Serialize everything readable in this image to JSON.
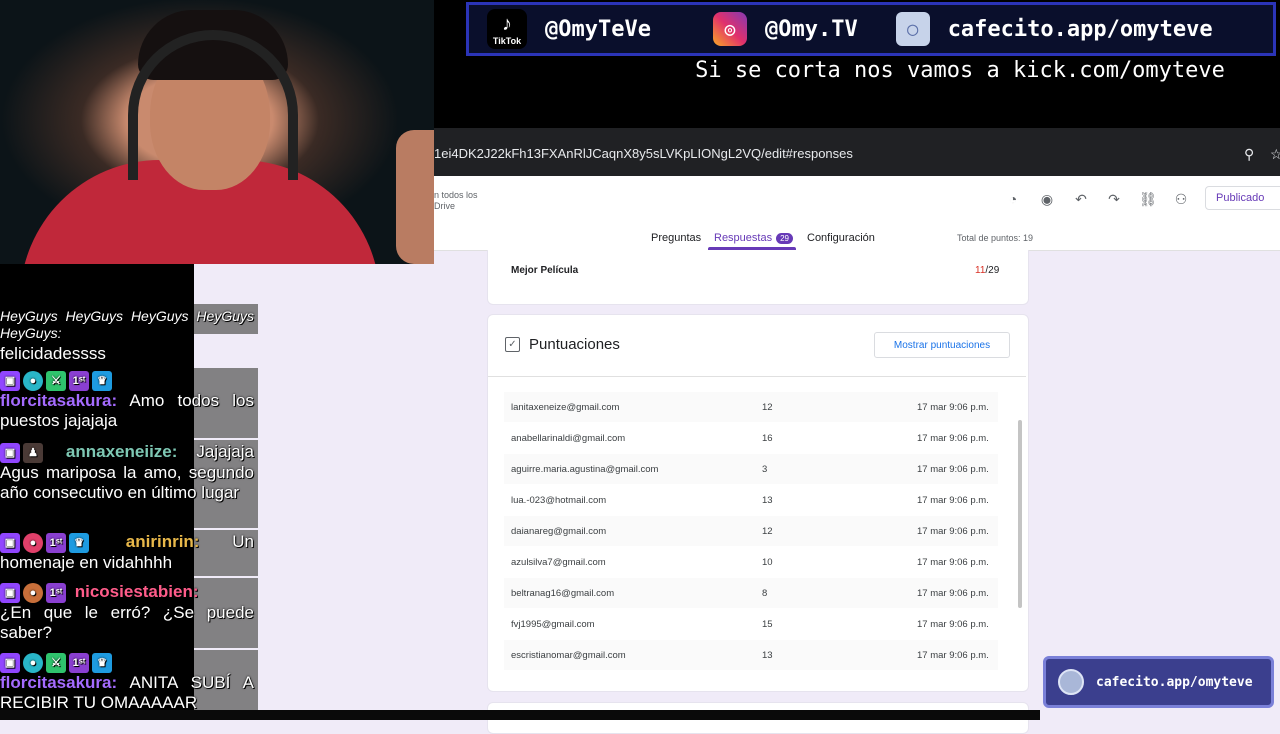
{
  "overlay": {
    "tiktok": {
      "icon": "tiktok-icon",
      "icon_label": "TikTok",
      "handle": "@OmyTeVe"
    },
    "instagram": {
      "icon": "instagram-icon",
      "handle": "@Omy.TV"
    },
    "cafecito": {
      "icon": "cafecito-icon",
      "handle": "cafecito.app/omyteve"
    },
    "banner": "Si se corta nos vamos a kick.com/omyteve",
    "bottom_badge": "cafecito.app/omyteve"
  },
  "chat": {
    "messages": [
      {
        "user": "",
        "text": "HeyGuys HeyGuys HeyGuys HeyGuys HeyGuys:"
      },
      {
        "user": "",
        "text": "felicidadessss"
      },
      {
        "user": "florcitasakura:",
        "user_color": "#a56bff",
        "text": "Amo todos los puestos jajajaja"
      },
      {
        "user": "annaxeneiize:",
        "user_color": "#7ec8b4",
        "text": "Jajajaja Agus mariposa la amo, segundo año consecutivo en último lugar"
      },
      {
        "user": "anirinrin:",
        "user_color": "#e8b84a",
        "text": "Un homenaje en vidahhhh"
      },
      {
        "user": "nicosiestabien:",
        "user_color": "#ff5c8a",
        "text": "¿En que le erró? ¿Se puede saber?"
      },
      {
        "user": "florcitasakura:",
        "user_color": "#a56bff",
        "text": "ANITA SUBÍ A RECIBIR TU OMAAAAAR"
      }
    ]
  },
  "browser": {
    "url": "1ei4DK2J22kFh13FXAnRlJCaqnX8y5sLVKpLIONgL2VQ/edit#responses",
    "zoom_icon": "zoom-icon",
    "star_icon": "star-icon"
  },
  "forms": {
    "drive_note_1": "n todos los",
    "drive_note_2": "Drive",
    "toolbar_icons": [
      "palette-icon",
      "preview-eye-icon",
      "undo-icon",
      "redo-icon",
      "link-icon",
      "add-collaborator-icon"
    ],
    "publish_label": "Publicado",
    "tabs": {
      "preguntas": "Preguntas",
      "respuestas": "Respuestas",
      "respuestas_count": "29",
      "configuracion": "Configuración"
    },
    "total_points": "Total de puntos: 19",
    "mejor_pelicula": {
      "label": "Mejor Película",
      "score_correct": "11",
      "score_total": "/29"
    },
    "puntuaciones": {
      "title": "Puntuaciones",
      "button": "Mostrar puntuaciones",
      "rows": [
        {
          "email": "lanitaxeneize@gmail.com",
          "score": "12",
          "date": "17 mar 9:06 p.m."
        },
        {
          "email": "anabellarinaldi@gmail.com",
          "score": "16",
          "date": "17 mar 9:06 p.m."
        },
        {
          "email": "aguirre.maria.agustina@gmail.com",
          "score": "3",
          "date": "17 mar 9:06 p.m."
        },
        {
          "email": "lua.-023@hotmail.com",
          "score": "13",
          "date": "17 mar 9:06 p.m."
        },
        {
          "email": "daianareg@gmail.com",
          "score": "12",
          "date": "17 mar 9:06 p.m."
        },
        {
          "email": "azulsilva7@gmail.com",
          "score": "10",
          "date": "17 mar 9:06 p.m."
        },
        {
          "email": "beltranag16@gmail.com",
          "score": "8",
          "date": "17 mar 9:06 p.m."
        },
        {
          "email": "fvj1995@gmail.com",
          "score": "15",
          "date": "17 mar 9:06 p.m."
        },
        {
          "email": "escristianomar@gmail.com",
          "score": "13",
          "date": "17 mar 9:06 p.m."
        }
      ]
    }
  },
  "colors": {
    "forms_accent": "#673ab7",
    "twitch": "#9146ff",
    "overlay_border": "#2b34b8"
  }
}
